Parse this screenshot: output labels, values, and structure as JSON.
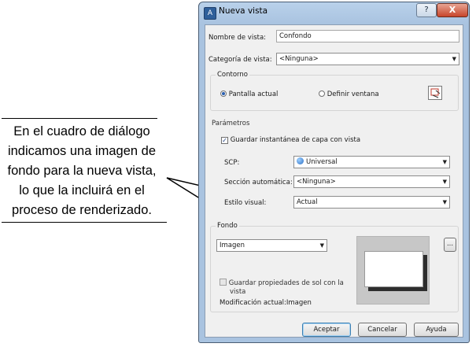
{
  "annotation": {
    "lines": [
      "En el cuadro de diálogo",
      "indicamos una imagen de",
      "fondo para la nueva vista,",
      "lo que la incluirá en el",
      "proceso de renderizado."
    ]
  },
  "window": {
    "title": "Nueva vista",
    "help_label": "?",
    "close_label": "X"
  },
  "dialog": {
    "view_name_label": "Nombre de vista:",
    "view_name_value": "Confondo",
    "view_category_label": "Categoría de vista:",
    "view_category_value": "<Ninguna>",
    "boundary": {
      "title": "Contorno",
      "current_display_label": "Pantalla actual",
      "define_window_label": "Definir ventana"
    },
    "parameters": {
      "title": "Parámetros",
      "save_layer_snapshot_label": "Guardar instantánea de capa con vista",
      "ucs_label": "SCP:",
      "ucs_value": "Universal",
      "live_section_label": "Sección automática:",
      "live_section_value": "<Ninguna>",
      "visual_style_label": "Estilo visual:",
      "visual_style_value": "Actual"
    },
    "background": {
      "title": "Fondo",
      "type_value": "Imagen",
      "browse_label": "...",
      "save_sun_label_line1": "Guardar propiedades de sol con la",
      "save_sun_label_line2": "vista",
      "current_override": "Modificación actual:Imagen"
    },
    "buttons": {
      "ok": "Aceptar",
      "cancel": "Cancelar",
      "help": "Ayuda"
    }
  }
}
